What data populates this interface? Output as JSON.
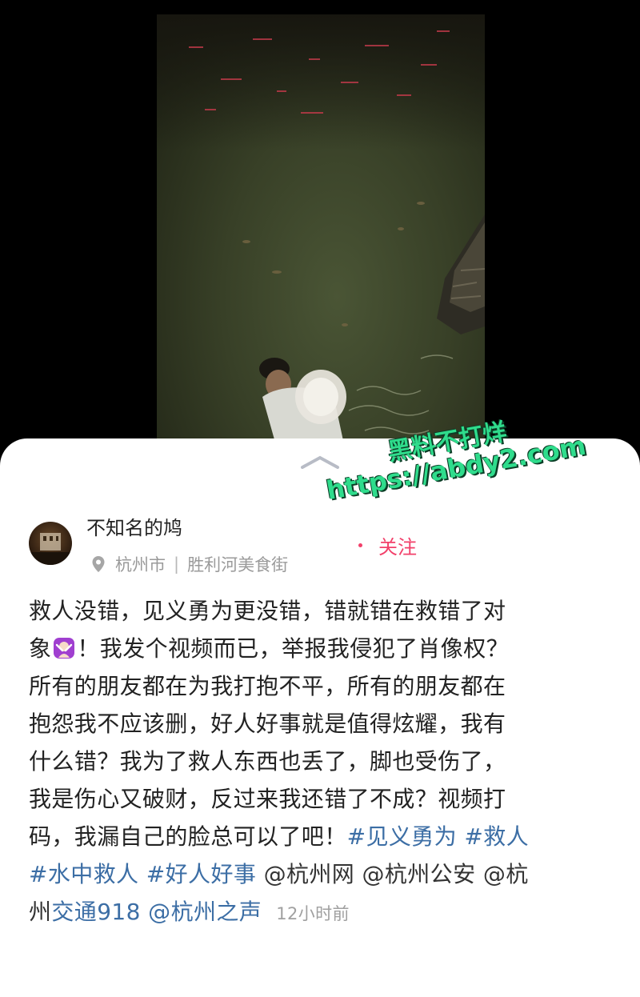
{
  "watermark": {
    "line1": "黑料不打烊",
    "line2": "https://abdy2.com"
  },
  "post": {
    "author": "不知名的鸠",
    "location": {
      "city": "杭州市",
      "separator": "|",
      "place": "胜利河美食街"
    },
    "follow_label": "关注",
    "lines": [
      [
        {
          "t": "救人没错，见义勇为更没错，错就错在救错了对"
        }
      ],
      [
        {
          "t": "象"
        },
        {
          "emoji": "person-gesturing-no"
        },
        {
          "t": "！我发个视频而已，举报我侵犯了肖像权？"
        }
      ],
      [
        {
          "t": "所有的朋友都在为我打抱不平，所有的朋友都在"
        }
      ],
      [
        {
          "t": "抱怨我不应该删，好人好事就是值得炫耀，我有"
        }
      ],
      [
        {
          "t": "什么错？我为了救人东西也丢了，脚也受伤了，"
        }
      ],
      [
        {
          "t": "我是伤心又破财，反过来我还错了不成？视频打"
        }
      ],
      [
        {
          "t": "码，我漏自己的脸总可以了吧！"
        },
        {
          "tag": "#见义勇为"
        },
        {
          "t": " "
        },
        {
          "tag": "#救人"
        }
      ],
      [
        {
          "tag": "#水中救人"
        },
        {
          "t": " "
        },
        {
          "tag": "#好人好事"
        },
        {
          "t": " "
        },
        {
          "mention": "@杭州网"
        },
        {
          "t": " "
        },
        {
          "mention": "@杭州公安"
        },
        {
          "t": " "
        },
        {
          "mention": "@杭"
        }
      ],
      [
        {
          "mention": "州"
        },
        {
          "mentionLink": "交通918"
        },
        {
          "t": " "
        },
        {
          "mentionLink": "@杭州之声"
        },
        {
          "time": "12小时前"
        }
      ]
    ]
  },
  "colors": {
    "hashtag": "#3c6ea5",
    "follow": "#f2406a",
    "watermark": "#2fdc8c"
  }
}
